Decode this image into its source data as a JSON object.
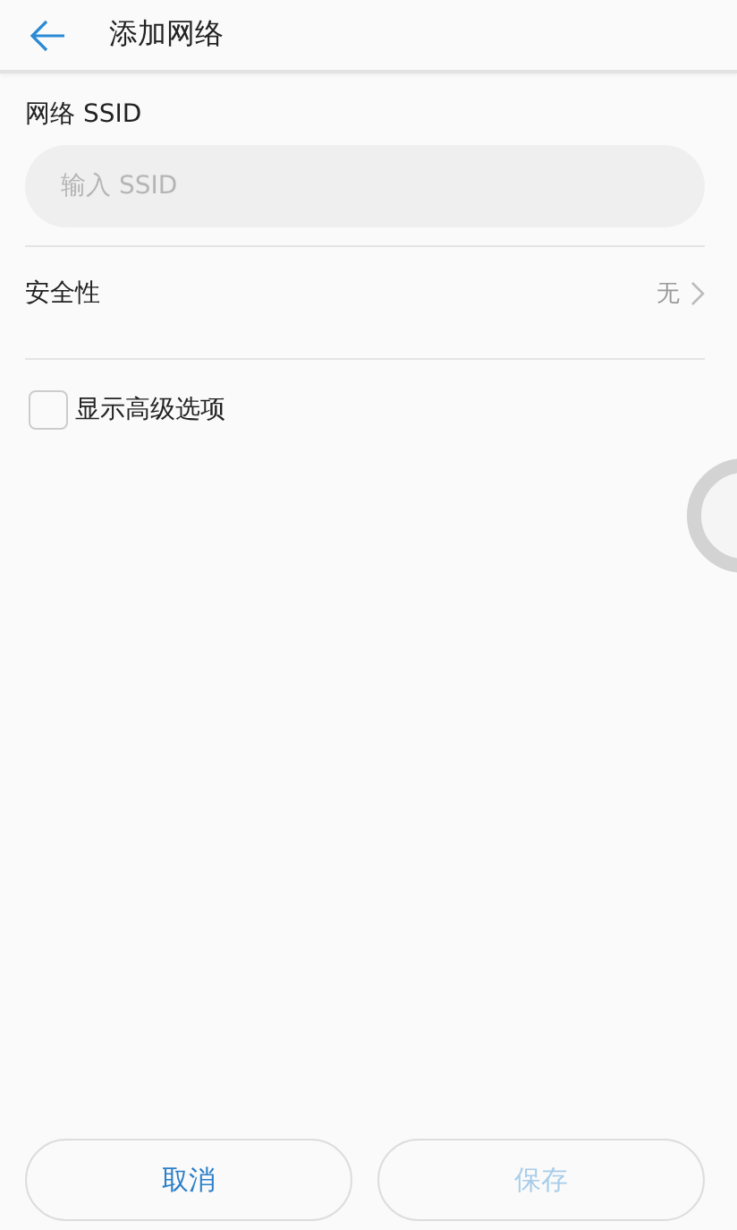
{
  "header": {
    "title": "添加网络"
  },
  "ssid": {
    "label": "网络 SSID",
    "placeholder": "输入 SSID"
  },
  "security": {
    "label": "安全性",
    "value": "无"
  },
  "advanced": {
    "label": "显示高级选项",
    "checked": false
  },
  "buttons": [
    {
      "label": "取消",
      "disabled": false
    },
    {
      "label": "保存",
      "disabled": true
    }
  ]
}
